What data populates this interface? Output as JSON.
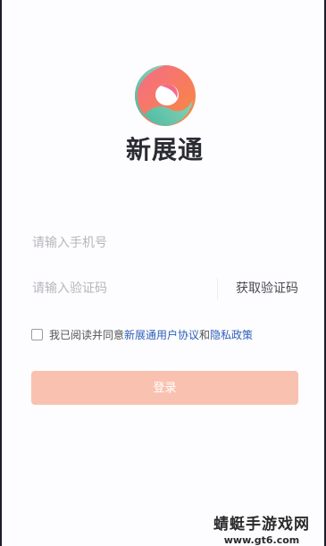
{
  "app": {
    "name": "新展通"
  },
  "form": {
    "phone_placeholder": "请输入手机号",
    "code_placeholder": "请输入验证码",
    "get_code_label": "获取验证码"
  },
  "agreement": {
    "prefix": "我已阅读并同意",
    "user_agreement": "新展通用户协议",
    "and": "和",
    "privacy_policy": "隐私政策"
  },
  "login_label": "登录",
  "watermark": {
    "title": "蜻蜓手游戏网",
    "url": "www.gt6.com"
  },
  "colors": {
    "accent": "#f9c2b0",
    "link": "#2f5fb8"
  }
}
